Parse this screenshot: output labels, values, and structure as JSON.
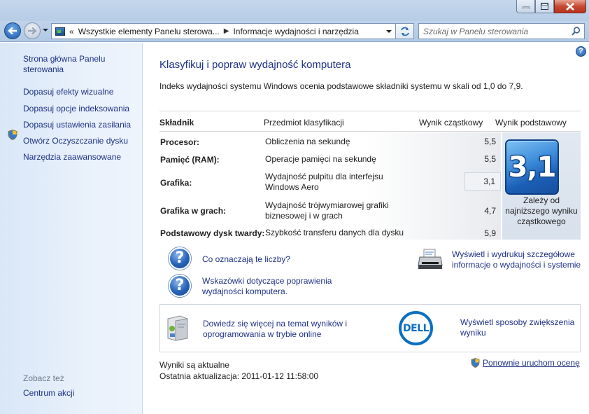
{
  "window": {
    "controls": [
      "minimize",
      "maximize",
      "close"
    ]
  },
  "navbar": {
    "breadcrumbs": [
      "Wszystkie elementy Panelu sterowa...",
      "Informacje wydajności i narzędzia"
    ],
    "breadcrumb_prefix": "«",
    "search_placeholder": "Szukaj w Panelu sterowania"
  },
  "sidebar": {
    "home": "Strona główna Panelu sterowania",
    "items": [
      "Dopasuj efekty wizualne",
      "Dopasuj opcje indeksowania",
      "Dopasuj ustawienia zasilania",
      "Otwórz Oczyszczanie dysku",
      "Narzędzia zaawansowane"
    ],
    "see_also_label": "Zobacz też",
    "see_also_items": [
      "Centrum akcji"
    ]
  },
  "main": {
    "title": "Klasyfikuj i popraw wydajność komputera",
    "description": "Indeks wydajności systemu Windows ocenia podstawowe składniki systemu w skali od 1,0 do 7,9.",
    "table": {
      "headers": {
        "component": "Składnik",
        "rating": "Przedmiot klasyfikacji",
        "subscore": "Wynik cząstkowy",
        "basescore": "Wynik podstawowy"
      },
      "rows": [
        {
          "component": "Procesor:",
          "rating": "Obliczenia na sekundę",
          "score": "5,5"
        },
        {
          "component": "Pamięć (RAM):",
          "rating": "Operacje pamięci na sekundę",
          "score": "5,5"
        },
        {
          "component": "Grafika:",
          "rating": "Wydajność pulpitu dla interfejsu Windows Aero",
          "score": "3,1"
        },
        {
          "component": "Grafika w grach:",
          "rating": "Wydajność trójwymiarowej grafiki biznesowej i w grach",
          "score": "4,7"
        },
        {
          "component": "Podstawowy dysk twardy:",
          "rating": "Szybkość transferu danych dla dysku",
          "score": "5,9"
        }
      ],
      "base_score": "3,1",
      "base_note": "Zależy od najniższego wyniku cząstkowego"
    },
    "links": {
      "what_numbers": "Co oznaczają te liczby?",
      "tips": "Wskazówki dotyczące poprawienia wydajności komputera.",
      "print": "Wyświetl i wydrukuj szczegółowe informacje o wydajności i systemie",
      "learn_more": "Dowiedz się więcej na temat wyników i oprogramowania w trybie online",
      "dell": "Wyświetl sposoby zwiększenia wyniku",
      "dell_logo": "DELL"
    },
    "status": {
      "current": "Wyniki są aktualne",
      "last_update": "Ostatnia aktualizacja: 2011-01-12 11:58:00",
      "rerun": "Ponownie uruchom ocenę"
    }
  },
  "colors": {
    "link": "#1e3287",
    "sidebar_bg": "#dfeaf8",
    "badge": "#2a78d0",
    "dell_blue": "#0b6fc0"
  }
}
